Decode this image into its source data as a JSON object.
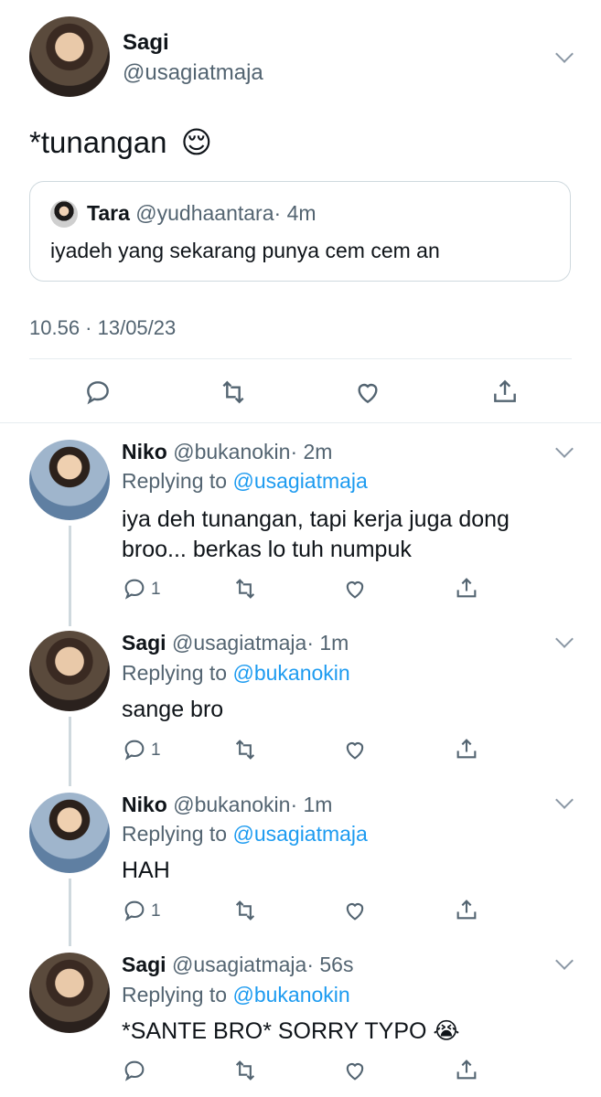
{
  "main_tweet": {
    "author_name": "Sagi",
    "author_handle": "@usagiatmaja",
    "text": "*tunangan",
    "emoji": "😌",
    "quoted": {
      "author_name": "Tara",
      "author_handle": "@yudhaantara",
      "time": "· 4m",
      "text": "iyadeh yang sekarang punya cem cem an"
    },
    "timestamp": "10.56 · 13/05/23"
  },
  "replies": [
    {
      "author_name": "Niko",
      "author_handle": "@bukanokin",
      "time": "· 2m",
      "replying_prefix": "Replying to",
      "replying_to": "@usagiatmaja",
      "text_line1": "iya deh tunangan, tapi kerja juga dong",
      "text_line2": "broo... berkas lo tuh numpuk",
      "reply_count": "1"
    },
    {
      "author_name": "Sagi",
      "author_handle": "@usagiatmaja",
      "time": "· 1m",
      "replying_prefix": "Replying to",
      "replying_to": "@bukanokin",
      "text_line1": "sange bro",
      "reply_count": "1"
    },
    {
      "author_name": "Niko",
      "author_handle": "@bukanokin",
      "time": "· 1m",
      "replying_prefix": "Replying to",
      "replying_to": "@usagiatmaja",
      "text_line1": "HAH",
      "reply_count": "1"
    },
    {
      "author_name": "Sagi",
      "author_handle": "@usagiatmaja",
      "time": "· 56s",
      "replying_prefix": "Replying to",
      "replying_to": "@bukanokin",
      "text_line1": "*SANTE BRO* SORRY TYPO",
      "emoji": "😭",
      "reply_count": ""
    }
  ],
  "colors": {
    "link": "#1d9bf0",
    "muted": "#536471",
    "divider": "#e6ecf0"
  },
  "icons": [
    "reply-icon",
    "retweet-icon",
    "like-icon",
    "share-icon",
    "chevron-down-icon"
  ]
}
